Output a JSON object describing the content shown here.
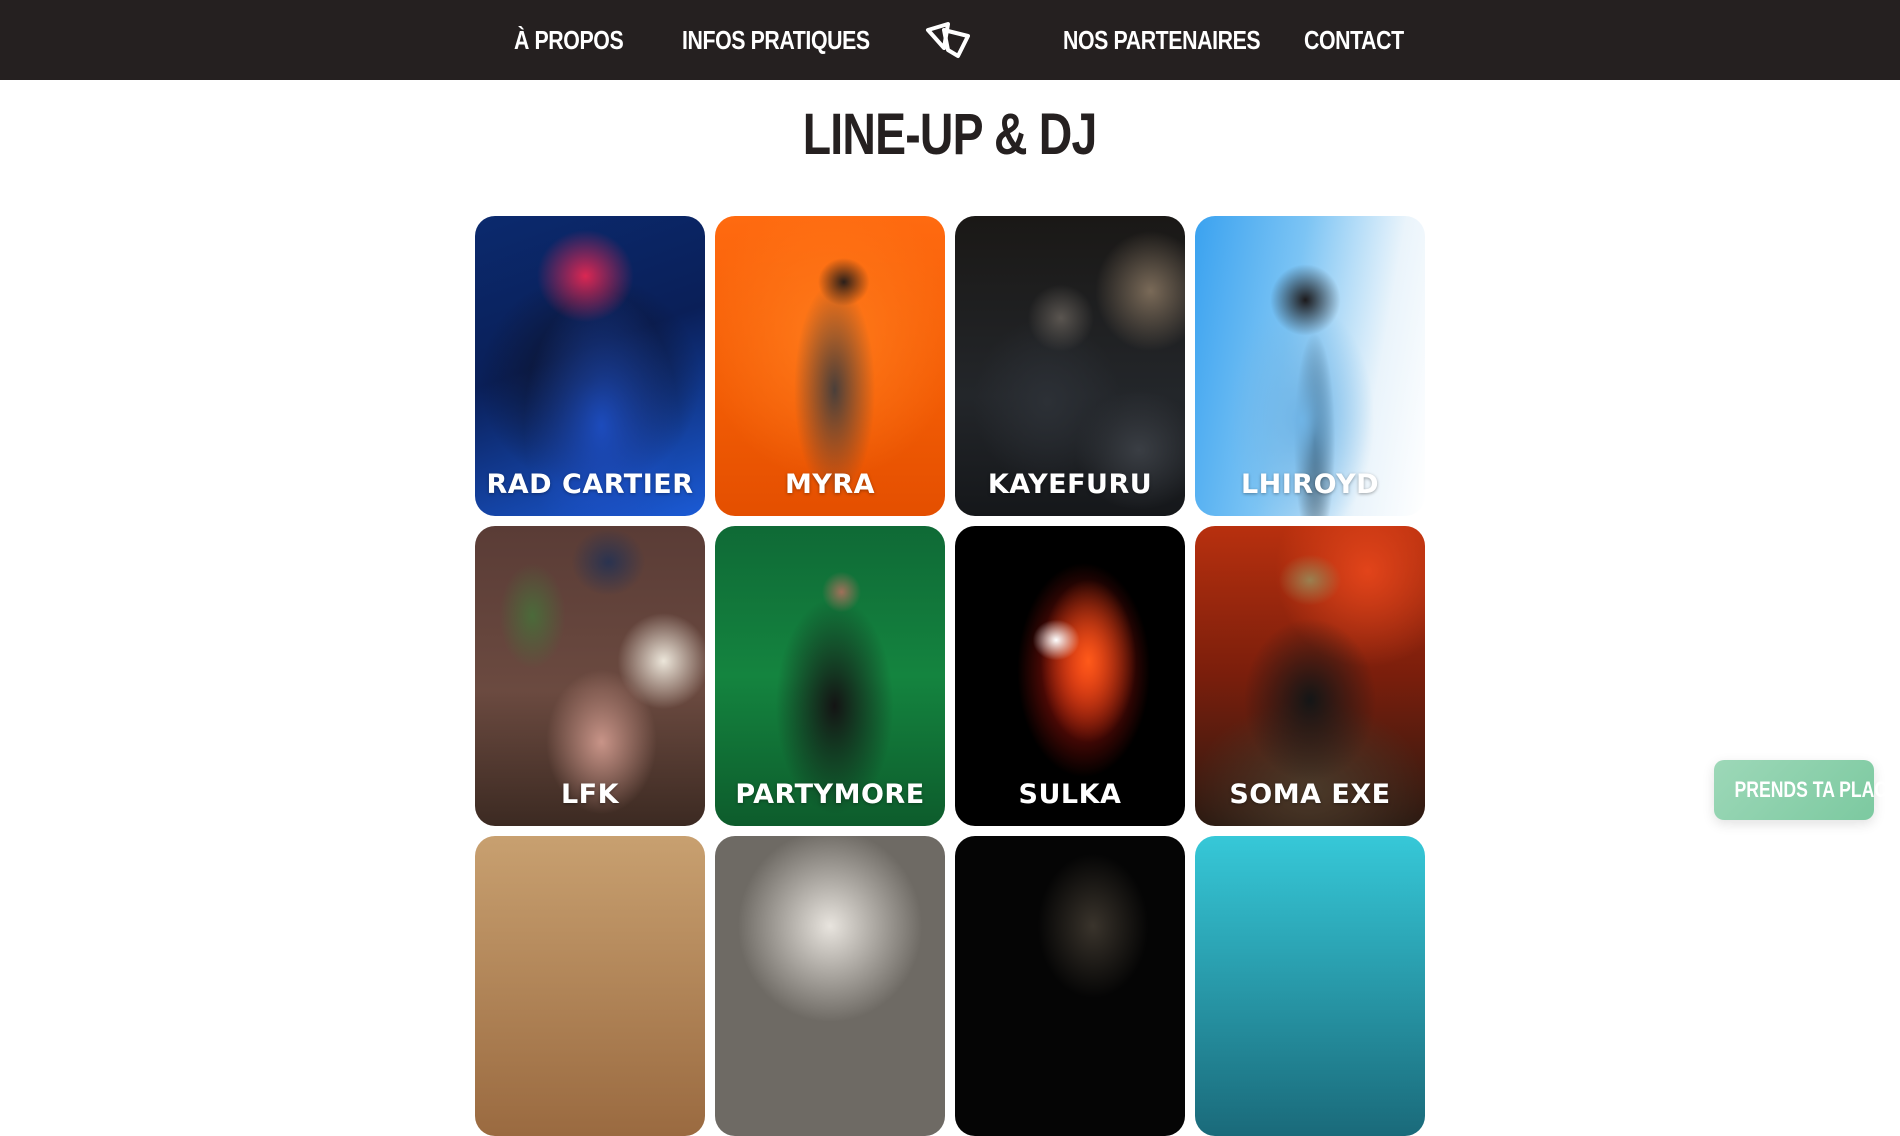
{
  "nav": {
    "items": [
      {
        "label": "À PROPOS"
      },
      {
        "label": "INFOS PRATIQUES"
      },
      {
        "label": "NOS PARTENAIRES"
      },
      {
        "label": "CONTACT"
      }
    ],
    "logo_icon": "bowtie-logo-icon",
    "background": "#252020"
  },
  "main": {
    "title": "LINE-UP & DJ"
  },
  "artists": [
    {
      "name": "RAD CARTIER"
    },
    {
      "name": "MYRA"
    },
    {
      "name": "KAYEFURU"
    },
    {
      "name": "LHIROYD"
    },
    {
      "name": "LFK"
    },
    {
      "name": "PARTYMORE"
    },
    {
      "name": "SULKA"
    },
    {
      "name": "SOMA EXE"
    }
  ],
  "cta": {
    "label": "PRENDS TA PLACE",
    "color": "#8fd1ad"
  }
}
